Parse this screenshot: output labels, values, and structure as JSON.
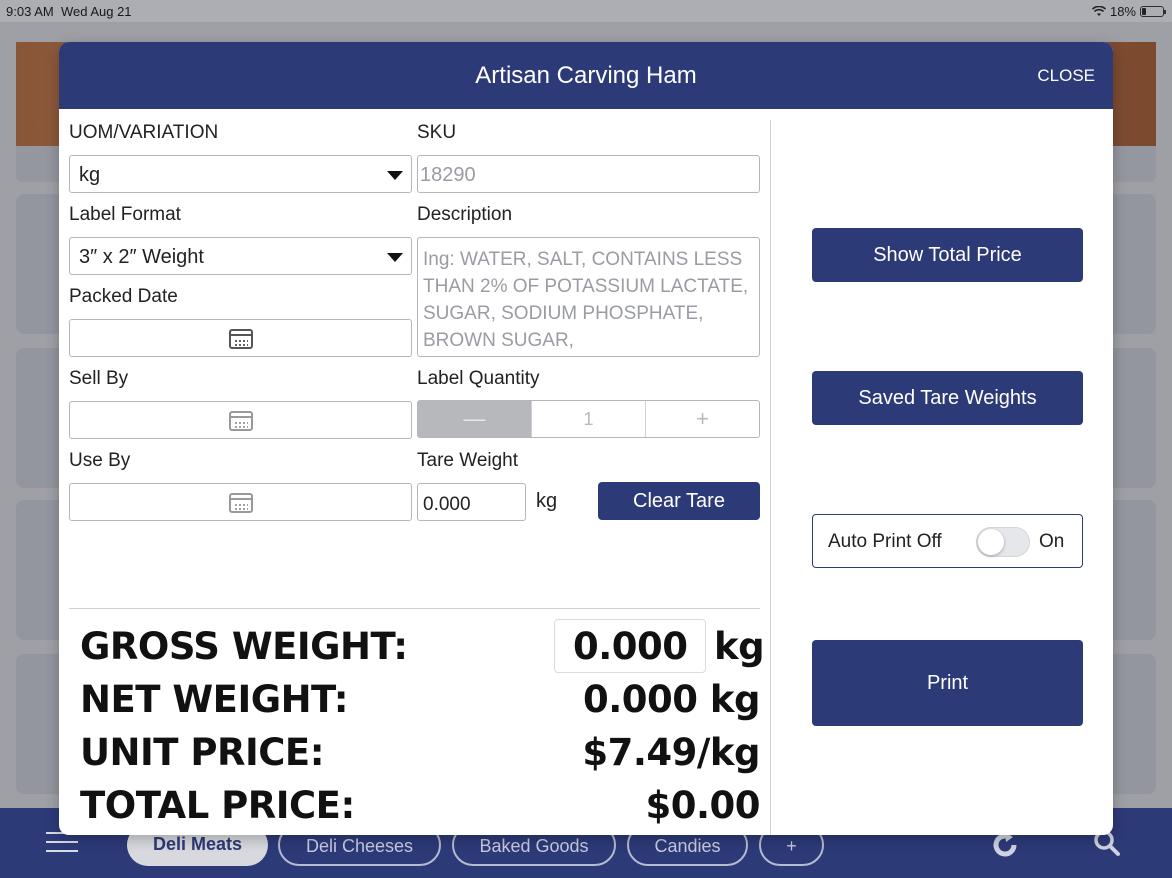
{
  "status_bar": {
    "time": "9:03 AM",
    "date": "Wed Aug 21",
    "battery": "18%"
  },
  "modal": {
    "title": "Artisan Carving Ham",
    "close_label": "CLOSE",
    "uom": {
      "label": "UOM/VARIATION",
      "value": "kg"
    },
    "sku": {
      "label": "SKU",
      "value": "18290"
    },
    "label_format": {
      "label": "Label Format",
      "value": "3″ x 2″ Weight"
    },
    "description": {
      "label": "Description",
      "value": "Ing: WATER, SALT, CONTAINS LESS THAN 2% OF POTASSIUM LACTATE, SUGAR, SODIUM PHOSPHATE, BROWN SUGAR,"
    },
    "packed_date": {
      "label": "Packed Date"
    },
    "sell_by": {
      "label": "Sell By"
    },
    "use_by": {
      "label": "Use By"
    },
    "label_quantity": {
      "label": "Label Quantity",
      "value": "1",
      "minus": "—",
      "plus": "+"
    },
    "tare_weight": {
      "label": "Tare Weight",
      "value": "0.000",
      "unit": "kg",
      "clear_label": "Clear Tare"
    },
    "totals": {
      "gross_label": "GROSS WEIGHT:",
      "gross_value": "0.000",
      "gross_unit": "kg",
      "net_label": "NET WEIGHT:",
      "net_value": "0.000 kg",
      "unit_price_label": "UNIT PRICE:",
      "unit_price_value": "$7.49/kg",
      "total_price_label": "TOTAL PRICE:",
      "total_price_value": "$0.00"
    },
    "actions": {
      "show_total_price": "Show Total Price",
      "saved_tare_weights": "Saved Tare Weights",
      "auto_print_off": "Auto Print Off",
      "auto_print_on": "On",
      "auto_print_enabled": false,
      "print": "Print"
    }
  },
  "tabbar": {
    "tabs": [
      {
        "label": "Deli Meats",
        "active": true
      },
      {
        "label": "Deli Cheeses",
        "active": false
      },
      {
        "label": "Baked Goods",
        "active": false
      },
      {
        "label": "Candies",
        "active": false
      },
      {
        "label": "+",
        "active": false
      }
    ]
  },
  "colors": {
    "brand_navy": "#2d3a78"
  }
}
